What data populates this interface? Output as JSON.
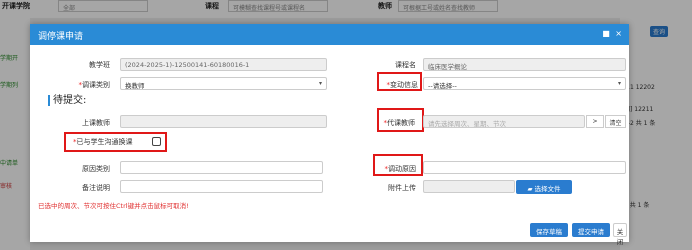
{
  "background": {
    "college_label": "开课学院",
    "college_value": "全部",
    "course_label": "课程",
    "course_placeholder": "可模糊查找课程号或课程名",
    "teacher_label": "教师",
    "teacher_placeholder": "可根据工号或姓名查找教师",
    "query_button": "查询",
    "left_fragments": [
      "学期开",
      "学期列",
      "中请单",
      "审核"
    ],
    "right_fragments": [
      "-11 12202",
      "期] 12211",
      "1-2 共 1 条",
      "1 共 1 条"
    ]
  },
  "dialog": {
    "title": "调停课申请",
    "controls": [
      "■",
      "×"
    ],
    "fields": {
      "class_label": "教学班",
      "class_value": "(2024-2025-1)-12500141-60180016-1",
      "course_name_label": "课程名",
      "course_name_value": "临床医学概论",
      "adjust_type_label": "调课类别",
      "adjust_type_value": "换教师",
      "change_info_label": "变动信息",
      "change_info_value": "--请选择--",
      "section_title": "待提交:",
      "teacher_label": "上课教师",
      "teacher_value": "",
      "substitute_label": "代课教师",
      "substitute_placeholder": "请先选择周次、星期、节次",
      "substitute_arrow_btn": ">",
      "substitute_clear_btn": "清空",
      "communicated_label": "已与学生沟通换课",
      "reason_type_label": "原因类别",
      "reason_type_value": "",
      "adjust_reason_label": "调动原因",
      "adjust_reason_value": "",
      "remark_label": "备注说明",
      "remark_value": "",
      "attachment_label": "附件上传",
      "attachment_value": "",
      "choose_file_btn": "选择文件"
    },
    "warning": "已选中的周次、节次可按住Ctrl键并点击鼠标可取消!",
    "buttons": {
      "save_draft": "保存草稿",
      "submit": "提交申请",
      "close": "关 闭"
    }
  },
  "colors": {
    "header": "#2a8bd6",
    "highlight_box": "#e01818",
    "required": "#e22222",
    "primary_button": "#2a7ccf"
  }
}
